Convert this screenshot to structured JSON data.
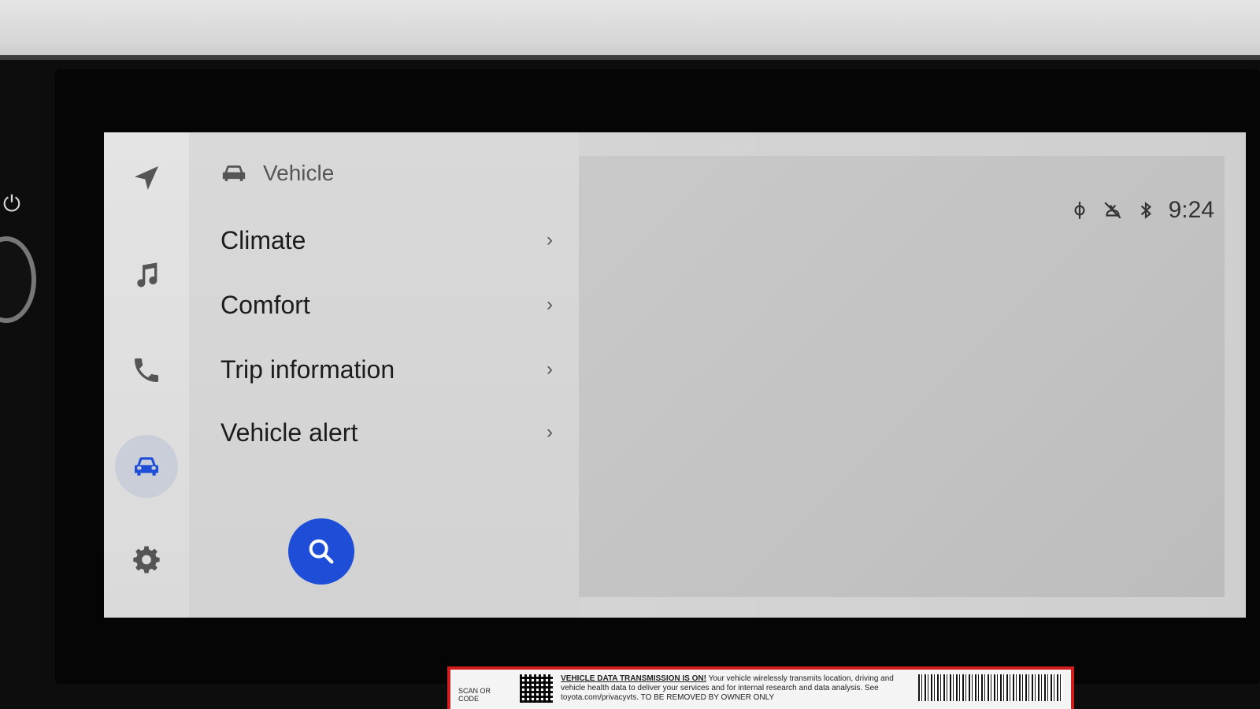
{
  "rail": {
    "items": [
      {
        "id": "navigation",
        "icon": "navigation-arrow-icon",
        "active": false
      },
      {
        "id": "media",
        "icon": "music-note-icon",
        "active": false
      },
      {
        "id": "phone",
        "icon": "phone-icon",
        "active": false
      },
      {
        "id": "vehicle",
        "icon": "car-icon",
        "active": true
      },
      {
        "id": "settings",
        "icon": "gear-icon",
        "active": false
      }
    ]
  },
  "panel": {
    "title": "Vehicle",
    "title_icon": "car-icon",
    "items": [
      {
        "label": "Climate"
      },
      {
        "label": "Comfort"
      },
      {
        "label": "Trip information"
      },
      {
        "label": "Vehicle alert"
      }
    ],
    "chevron": "›"
  },
  "status": {
    "time": "9:24",
    "icons": [
      "wireless-charging-icon",
      "voice-off-icon",
      "bluetooth-icon"
    ]
  },
  "colors": {
    "accent": "#1e4ed8",
    "screen_bg": "#d6d6d6",
    "sticker_border": "#d11d1d"
  },
  "sticker": {
    "scan_label": "SCAN OR CODE",
    "heading": "VEHICLE DATA TRANSMISSION IS ON!",
    "body": "Your vehicle wirelessly transmits location, driving and vehicle health data to deliver your services and for internal research and data analysis. See toyota.com/privacyvts.",
    "footer": "TO BE REMOVED BY OWNER ONLY"
  }
}
